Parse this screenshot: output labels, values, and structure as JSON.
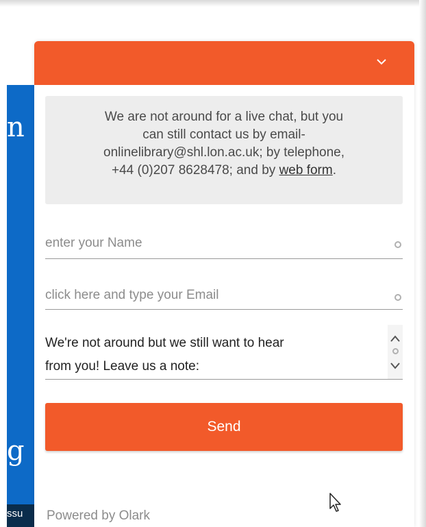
{
  "background": {
    "fragment_top": "n",
    "fragment_bottom": "g",
    "fragment_strip": "ssu",
    "colors": {
      "blue": "#0d6ac7",
      "strip": "#0a2d4c"
    }
  },
  "widget": {
    "header_icon": "chevron-down-icon",
    "accent_color": "#f25a2a",
    "message": {
      "line1": "We are not around for a live chat, but you",
      "line2": "can still contact us by email-",
      "line3": "onlinelibrary@shl.lon.ac.uk; by telephone,",
      "line4_text": "+44 (0)207 8628478; and by ",
      "line4_link": "web form",
      "line4_end": "."
    },
    "name_field": {
      "placeholder": "enter your Name"
    },
    "email_field": {
      "placeholder": "click here and type your Email"
    },
    "note_field": {
      "line1": "We're not around but we still want to hear",
      "line2": "from you!  Leave us a note:"
    },
    "send_label": "Send",
    "footer": "Powered by Olark"
  }
}
